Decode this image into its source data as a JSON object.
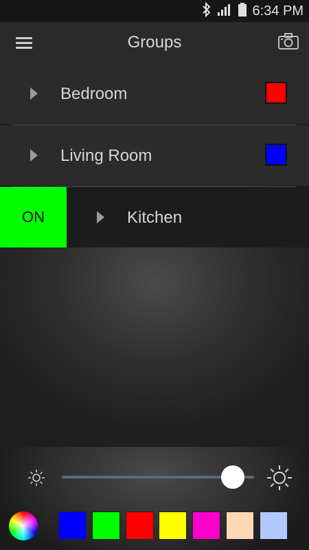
{
  "status_bar": {
    "time": "6:34 PM",
    "icons": [
      "bluetooth-icon",
      "signal-icon",
      "battery-icon"
    ]
  },
  "app_bar": {
    "title": "Groups",
    "menu_icon": "hamburger-menu-icon",
    "camera_icon": "camera-icon"
  },
  "groups": [
    {
      "name": "Bedroom",
      "color": "#ff0000",
      "expanded": false
    },
    {
      "name": "Living Room",
      "color": "#0000ff",
      "expanded": false
    },
    {
      "name": "Kitchen",
      "on_label": "ON",
      "on_color": "#00ff00"
    }
  ],
  "brightness": {
    "level_percent": 89,
    "min_icon": "brightness-low-icon",
    "max_icon": "brightness-high-icon"
  },
  "color_picker": {
    "wheel_icon": "color-wheel-icon",
    "swatches": [
      "#0000ff",
      "#00ff00",
      "#ff0000",
      "#ffff00",
      "#ff00cc",
      "#ffd9b3",
      "#b3c8ff"
    ]
  }
}
